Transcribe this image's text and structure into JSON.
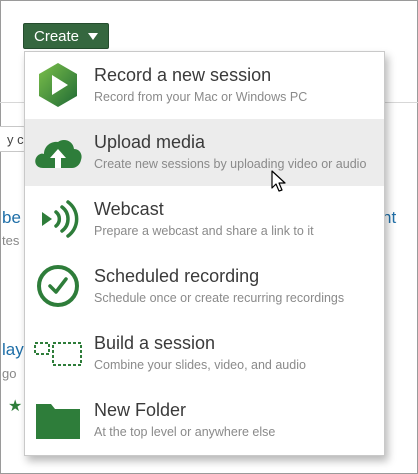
{
  "toolbar": {
    "create_label": "Create",
    "create_caret_icon": "caret-down-icon"
  },
  "background": {
    "search_fragment": "y c",
    "right_link_fragment": "nt",
    "left_link_fragment_1": "be",
    "left_gray_fragment_1": "tes",
    "left_link_fragment_2": "lay",
    "left_gray_fragment_2": "go"
  },
  "menu": {
    "items": [
      {
        "icon": "panopto-record-icon",
        "title": "Record a new session",
        "description": "Record from your Mac or Windows PC",
        "highlighted": false
      },
      {
        "icon": "cloud-upload-icon",
        "title": "Upload media",
        "description": "Create new sessions by uploading video or audio",
        "highlighted": true
      },
      {
        "icon": "broadcast-icon",
        "title": "Webcast",
        "description": "Prepare a webcast and share a link to it",
        "highlighted": false
      },
      {
        "icon": "clock-icon",
        "title": "Scheduled recording",
        "description": "Schedule once or create recurring recordings",
        "highlighted": false
      },
      {
        "icon": "build-session-icon",
        "title": "Build a session",
        "description": "Combine your slides, video, and audio",
        "highlighted": false
      },
      {
        "icon": "folder-icon",
        "title": "New Folder",
        "description": "At the top level or anywhere else",
        "highlighted": false
      }
    ]
  },
  "colors": {
    "brand_green": "#35673f",
    "icon_green": "#2e7d3a",
    "highlight_bg": "#ececec"
  }
}
